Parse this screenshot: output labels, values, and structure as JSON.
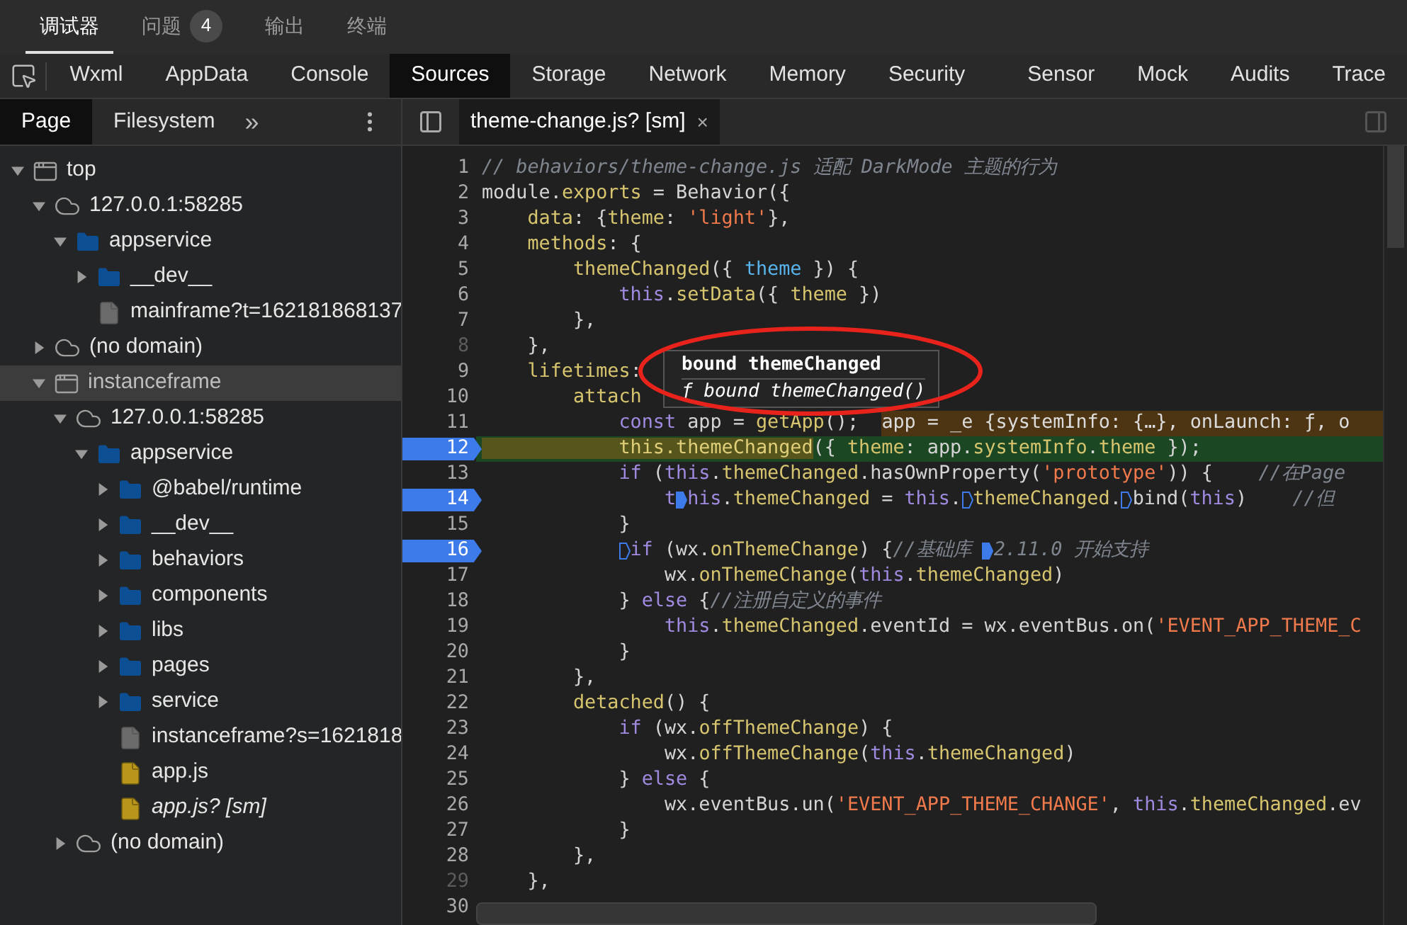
{
  "top_tabs": [
    {
      "label": "调试器",
      "selected": true
    },
    {
      "label": "问题",
      "selected": false,
      "badge": "4"
    },
    {
      "label": "输出",
      "selected": false
    },
    {
      "label": "终端",
      "selected": false
    }
  ],
  "panel_tabs": [
    {
      "label": "Wxml",
      "selected": false
    },
    {
      "label": "AppData",
      "selected": false
    },
    {
      "label": "Console",
      "selected": false
    },
    {
      "label": "Sources",
      "selected": true
    },
    {
      "label": "Storage",
      "selected": false
    },
    {
      "label": "Network",
      "selected": false
    },
    {
      "label": "Memory",
      "selected": false
    },
    {
      "label": "Security",
      "selected": false
    },
    {
      "label": "Sensor",
      "selected": false
    },
    {
      "label": "Mock",
      "selected": false
    },
    {
      "label": "Audits",
      "selected": false
    },
    {
      "label": "Trace",
      "selected": false
    }
  ],
  "navigator_tabs": [
    {
      "label": "Page",
      "selected": true
    },
    {
      "label": "Filesystem",
      "selected": false
    }
  ],
  "more_tabs": "»",
  "tree": [
    {
      "kind": "frame",
      "label": "top",
      "expanded": true,
      "selected": false,
      "children": [
        {
          "kind": "domain",
          "label": "127.0.0.1:58285",
          "expanded": true,
          "selected": false,
          "children": [
            {
              "kind": "folder",
              "label": "appservice",
              "expanded": true,
              "selected": false,
              "children": [
                {
                  "kind": "folder",
                  "label": "__dev__",
                  "expanded": false,
                  "selected": false
                },
                {
                  "kind": "document",
                  "label": "mainframe?t=162181868137",
                  "selected": false
                }
              ]
            }
          ]
        },
        {
          "kind": "domain",
          "label": "(no domain)",
          "expanded": false,
          "selected": false
        },
        {
          "kind": "frame",
          "label": "instanceframe",
          "expanded": true,
          "selected": true,
          "children": [
            {
              "kind": "domain",
              "label": "127.0.0.1:58285",
              "expanded": true,
              "selected": false,
              "children": [
                {
                  "kind": "folder",
                  "label": "appservice",
                  "expanded": true,
                  "selected": false,
                  "children": [
                    {
                      "kind": "folder",
                      "label": "@babel/runtime",
                      "expanded": false,
                      "selected": false
                    },
                    {
                      "kind": "folder",
                      "label": "__dev__",
                      "expanded": false,
                      "selected": false
                    },
                    {
                      "kind": "folder",
                      "label": "behaviors",
                      "expanded": false,
                      "selected": false
                    },
                    {
                      "kind": "folder",
                      "label": "components",
                      "expanded": false,
                      "selected": false
                    },
                    {
                      "kind": "folder",
                      "label": "libs",
                      "expanded": false,
                      "selected": false
                    },
                    {
                      "kind": "folder",
                      "label": "pages",
                      "expanded": false,
                      "selected": false
                    },
                    {
                      "kind": "folder",
                      "label": "service",
                      "expanded": false,
                      "selected": false
                    },
                    {
                      "kind": "document",
                      "label": "instanceframe?s=1621818",
                      "selected": false
                    },
                    {
                      "kind": "script",
                      "label": "app.js",
                      "selected": false
                    },
                    {
                      "kind": "sourcemap",
                      "label": "app.js? [sm]",
                      "selected": false
                    }
                  ]
                }
              ]
            },
            {
              "kind": "domain",
              "label": "(no domain)",
              "expanded": false,
              "selected": false
            }
          ]
        }
      ]
    }
  ],
  "editor_tab": {
    "label": "theme-change.js? [sm]",
    "close": "×"
  },
  "code_lines": [
    {
      "number": "1",
      "mapped": true,
      "breakpoint": false,
      "current": false,
      "tokens": [
        {
          "kind": "comment",
          "text": "// behaviors/theme-change.js 适配 DarkMode 主题的行为"
        }
      ]
    },
    {
      "number": "2",
      "mapped": true,
      "breakpoint": false,
      "current": false,
      "tokens": [
        {
          "kind": "plain",
          "text": "module."
        },
        {
          "kind": "prop",
          "text": "exports"
        },
        {
          "kind": "plain",
          "text": " = Behavior({"
        }
      ]
    },
    {
      "number": "3",
      "mapped": true,
      "breakpoint": false,
      "current": false,
      "tokens": [
        {
          "kind": "prop",
          "text": "    data"
        },
        {
          "kind": "plain",
          "text": ": {"
        },
        {
          "kind": "prop",
          "text": "theme"
        },
        {
          "kind": "plain",
          "text": ": "
        },
        {
          "kind": "string",
          "text": "'light'"
        },
        {
          "kind": "plain",
          "text": "},"
        }
      ]
    },
    {
      "number": "4",
      "mapped": true,
      "breakpoint": false,
      "current": false,
      "tokens": [
        {
          "kind": "prop",
          "text": "    methods"
        },
        {
          "kind": "plain",
          "text": ": {"
        }
      ]
    },
    {
      "number": "5",
      "mapped": true,
      "breakpoint": false,
      "current": false,
      "tokens": [
        {
          "kind": "prop",
          "text": "        themeChanged"
        },
        {
          "kind": "plain",
          "text": "({ "
        },
        {
          "kind": "var",
          "text": "theme"
        },
        {
          "kind": "plain",
          "text": " }) {"
        }
      ]
    },
    {
      "number": "6",
      "mapped": true,
      "breakpoint": false,
      "current": false,
      "tokens": [
        {
          "kind": "keyword",
          "text": "            this"
        },
        {
          "kind": "plain",
          "text": "."
        },
        {
          "kind": "prop",
          "text": "setData"
        },
        {
          "kind": "plain",
          "text": "({ "
        },
        {
          "kind": "prop",
          "text": "theme"
        },
        {
          "kind": "plain",
          "text": " })"
        }
      ]
    },
    {
      "number": "7",
      "mapped": true,
      "breakpoint": false,
      "current": false,
      "tokens": [
        {
          "kind": "plain",
          "text": "        },"
        }
      ]
    },
    {
      "number": "8",
      "mapped": false,
      "breakpoint": false,
      "current": false,
      "tokens": [
        {
          "kind": "plain",
          "text": "    },"
        }
      ]
    },
    {
      "number": "9",
      "mapped": true,
      "breakpoint": false,
      "current": false,
      "tokens": [
        {
          "kind": "prop",
          "text": "    lifetimes"
        },
        {
          "kind": "plain",
          "text": ":"
        }
      ]
    },
    {
      "number": "10",
      "mapped": true,
      "breakpoint": false,
      "current": false,
      "tokens": [
        {
          "kind": "prop",
          "text": "        attach"
        }
      ]
    },
    {
      "number": "11",
      "mapped": true,
      "breakpoint": false,
      "current": false,
      "tokens": [
        {
          "kind": "keyword",
          "text": "            const"
        },
        {
          "kind": "plain",
          "text": " app = "
        },
        {
          "kind": "prop",
          "text": "getApp"
        },
        {
          "kind": "plain",
          "text": "();  "
        },
        {
          "kind": "inline-value",
          "text": "app = _e {systemInfo: {…}, onLaunch: ƒ, o"
        }
      ]
    },
    {
      "number": "12",
      "mapped": true,
      "breakpoint": true,
      "current": true,
      "tokens": [
        {
          "kind": "highlight",
          "text": "            this.themeChanged"
        },
        {
          "kind": "plain",
          "text": "({ "
        },
        {
          "kind": "prop",
          "text": "theme"
        },
        {
          "kind": "plain",
          "text": ": app."
        },
        {
          "kind": "prop",
          "text": "systemInfo"
        },
        {
          "kind": "plain",
          "text": "."
        },
        {
          "kind": "prop",
          "text": "theme"
        },
        {
          "kind": "plain",
          "text": " });"
        }
      ]
    },
    {
      "number": "13",
      "mapped": true,
      "breakpoint": false,
      "current": false,
      "tokens": [
        {
          "kind": "keyword",
          "text": "            if"
        },
        {
          "kind": "plain",
          "text": " ("
        },
        {
          "kind": "keyword",
          "text": "this"
        },
        {
          "kind": "plain",
          "text": "."
        },
        {
          "kind": "prop",
          "text": "themeChanged"
        },
        {
          "kind": "plain",
          "text": ".hasOwnProperty("
        },
        {
          "kind": "string",
          "text": "'prototype'"
        },
        {
          "kind": "plain",
          "text": ")) {    "
        },
        {
          "kind": "comment",
          "text": "//在Page"
        }
      ]
    },
    {
      "number": "14",
      "mapped": true,
      "breakpoint": true,
      "current": false,
      "tokens": [
        {
          "kind": "keyword",
          "text": "                t"
        },
        {
          "kind": "keyword",
          "text": "his",
          "marker": true,
          "filled": true
        },
        {
          "kind": "plain",
          "text": "."
        },
        {
          "kind": "prop",
          "text": "themeChanged"
        },
        {
          "kind": "plain",
          "text": " = "
        },
        {
          "kind": "keyword",
          "text": "this"
        },
        {
          "kind": "plain",
          "text": "."
        },
        {
          "kind": "prop",
          "text": "themeChanged",
          "marker": true,
          "filled": false
        },
        {
          "kind": "plain",
          "text": "."
        },
        {
          "kind": "plain",
          "text": "bind(",
          "marker": true,
          "filled": false
        },
        {
          "kind": "keyword",
          "text": "this"
        },
        {
          "kind": "plain",
          "text": ")    "
        },
        {
          "kind": "comment",
          "text": "//但"
        }
      ]
    },
    {
      "number": "15",
      "mapped": true,
      "breakpoint": false,
      "current": false,
      "tokens": [
        {
          "kind": "plain",
          "text": "            }"
        }
      ]
    },
    {
      "number": "16",
      "mapped": true,
      "breakpoint": true,
      "current": false,
      "tokens": [
        {
          "kind": "keyword",
          "text": "            if",
          "marker": true,
          "filled": false
        },
        {
          "kind": "plain",
          "text": " (wx."
        },
        {
          "kind": "prop",
          "text": "onThemeChange"
        },
        {
          "kind": "plain",
          "text": ") {"
        },
        {
          "kind": "comment",
          "text": "//基础库 "
        },
        {
          "kind": "comment",
          "text": "2.11.0 开始支持",
          "marker": true,
          "filled": true
        }
      ]
    },
    {
      "number": "17",
      "mapped": true,
      "breakpoint": false,
      "current": false,
      "tokens": [
        {
          "kind": "plain",
          "text": "                wx."
        },
        {
          "kind": "prop",
          "text": "onThemeChange"
        },
        {
          "kind": "plain",
          "text": "("
        },
        {
          "kind": "keyword",
          "text": "this"
        },
        {
          "kind": "plain",
          "text": "."
        },
        {
          "kind": "prop",
          "text": "themeChanged"
        },
        {
          "kind": "plain",
          "text": ")"
        }
      ]
    },
    {
      "number": "18",
      "mapped": true,
      "breakpoint": false,
      "current": false,
      "tokens": [
        {
          "kind": "plain",
          "text": "            } "
        },
        {
          "kind": "keyword",
          "text": "else"
        },
        {
          "kind": "plain",
          "text": " {"
        },
        {
          "kind": "comment",
          "text": "//注册自定义的事件"
        }
      ]
    },
    {
      "number": "19",
      "mapped": true,
      "breakpoint": false,
      "current": false,
      "tokens": [
        {
          "kind": "keyword",
          "text": "                this"
        },
        {
          "kind": "plain",
          "text": "."
        },
        {
          "kind": "prop",
          "text": "themeChanged"
        },
        {
          "kind": "plain",
          "text": ".eventId = wx.eventBus.on("
        },
        {
          "kind": "string",
          "text": "'EVENT_APP_THEME_C"
        }
      ]
    },
    {
      "number": "20",
      "mapped": true,
      "breakpoint": false,
      "current": false,
      "tokens": [
        {
          "kind": "plain",
          "text": "            }"
        }
      ]
    },
    {
      "number": "21",
      "mapped": true,
      "breakpoint": false,
      "current": false,
      "tokens": [
        {
          "kind": "plain",
          "text": "        },"
        }
      ]
    },
    {
      "number": "22",
      "mapped": true,
      "breakpoint": false,
      "current": false,
      "tokens": [
        {
          "kind": "prop",
          "text": "        detached"
        },
        {
          "kind": "plain",
          "text": "() {"
        }
      ]
    },
    {
      "number": "23",
      "mapped": true,
      "breakpoint": false,
      "current": false,
      "tokens": [
        {
          "kind": "keyword",
          "text": "            if"
        },
        {
          "kind": "plain",
          "text": " (wx."
        },
        {
          "kind": "prop",
          "text": "offThemeChange"
        },
        {
          "kind": "plain",
          "text": ") {"
        }
      ]
    },
    {
      "number": "24",
      "mapped": true,
      "breakpoint": false,
      "current": false,
      "tokens": [
        {
          "kind": "plain",
          "text": "                wx."
        },
        {
          "kind": "prop",
          "text": "offThemeChange"
        },
        {
          "kind": "plain",
          "text": "("
        },
        {
          "kind": "keyword",
          "text": "this"
        },
        {
          "kind": "plain",
          "text": "."
        },
        {
          "kind": "prop",
          "text": "themeChanged"
        },
        {
          "kind": "plain",
          "text": ")"
        }
      ]
    },
    {
      "number": "25",
      "mapped": true,
      "breakpoint": false,
      "current": false,
      "tokens": [
        {
          "kind": "plain",
          "text": "            } "
        },
        {
          "kind": "keyword",
          "text": "else"
        },
        {
          "kind": "plain",
          "text": " {"
        }
      ]
    },
    {
      "number": "26",
      "mapped": true,
      "breakpoint": false,
      "current": false,
      "tokens": [
        {
          "kind": "plain",
          "text": "                wx.eventBus.un("
        },
        {
          "kind": "string",
          "text": "'EVENT_APP_THEME_CHANGE'"
        },
        {
          "kind": "plain",
          "text": ", "
        },
        {
          "kind": "keyword",
          "text": "this"
        },
        {
          "kind": "plain",
          "text": "."
        },
        {
          "kind": "prop",
          "text": "themeChanged"
        },
        {
          "kind": "plain",
          "text": ".ev"
        }
      ]
    },
    {
      "number": "27",
      "mapped": true,
      "breakpoint": false,
      "current": false,
      "tokens": [
        {
          "kind": "plain",
          "text": "            }"
        }
      ]
    },
    {
      "number": "28",
      "mapped": true,
      "breakpoint": false,
      "current": false,
      "tokens": [
        {
          "kind": "plain",
          "text": "        },"
        }
      ]
    },
    {
      "number": "29",
      "mapped": false,
      "breakpoint": false,
      "current": false,
      "tokens": [
        {
          "kind": "plain",
          "text": "    },"
        }
      ]
    },
    {
      "number": "30",
      "mapped": true,
      "breakpoint": false,
      "current": false
    }
  ],
  "tooltip": {
    "title": "bound themeChanged",
    "signature": "ƒ bound themeChanged()"
  }
}
